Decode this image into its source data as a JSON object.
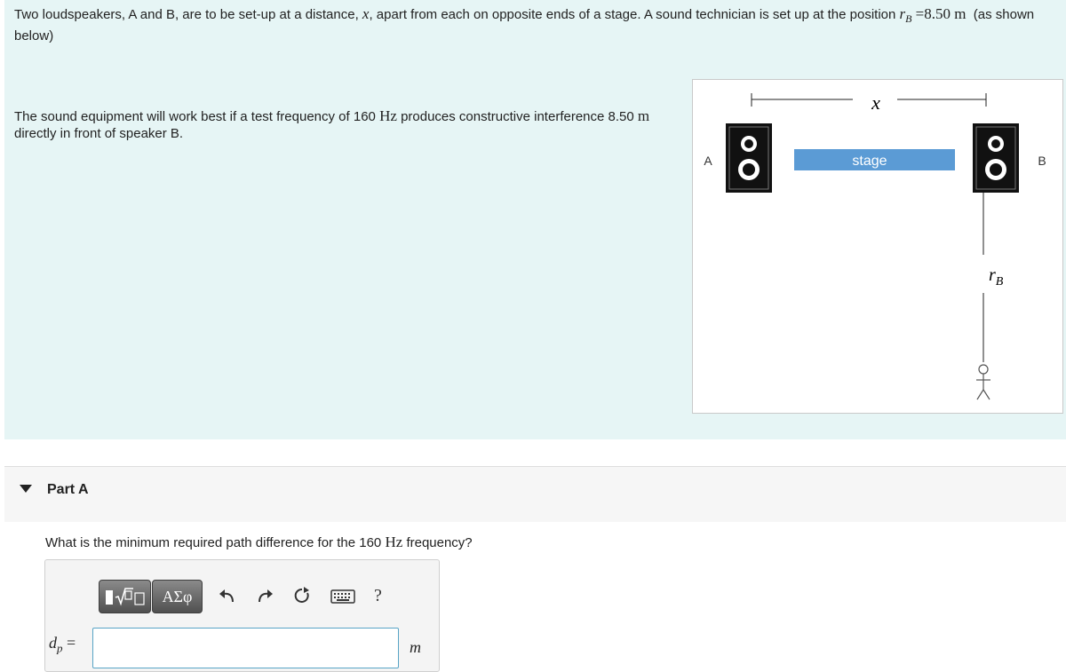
{
  "problem": {
    "p1_a": "Two loudspeakers, A and B, are to be set-up at a distance,",
    "p1_x": "x",
    "p1_b": ", apart from each on opposite ends of a stage. A sound technician is set up at the position",
    "p1_r": "r",
    "p1_rsub": "B",
    "p1_eq": "=8.50",
    "p1_unit": "m",
    "p1_c": "(as shown below)",
    "p2_a": "The sound equipment will work best if a test frequency of 160",
    "p2_hz": "Hz",
    "p2_b": "produces constructive interference 8.50",
    "p2_m": "m",
    "p2_c": "directly in front of speaker B."
  },
  "figure": {
    "label_a": "A",
    "label_b": "B",
    "stage_label": "stage",
    "x_label": "x",
    "rb_r": "r",
    "rb_sub": "B"
  },
  "part": {
    "label": "Part A",
    "question_a": "What is the minimum required path difference for the 160",
    "question_hz": "Hz",
    "question_b": "frequency?",
    "greek_button": "ΑΣφ",
    "help_button": "?",
    "answer_var": "d",
    "answer_sub": "p",
    "answer_eq": "=",
    "answer_value": "",
    "unit": "m"
  },
  "colors": {
    "intro_bg": "#e6f5f5",
    "stage_fill": "#5b9bd5",
    "input_border": "#58a4c6"
  }
}
